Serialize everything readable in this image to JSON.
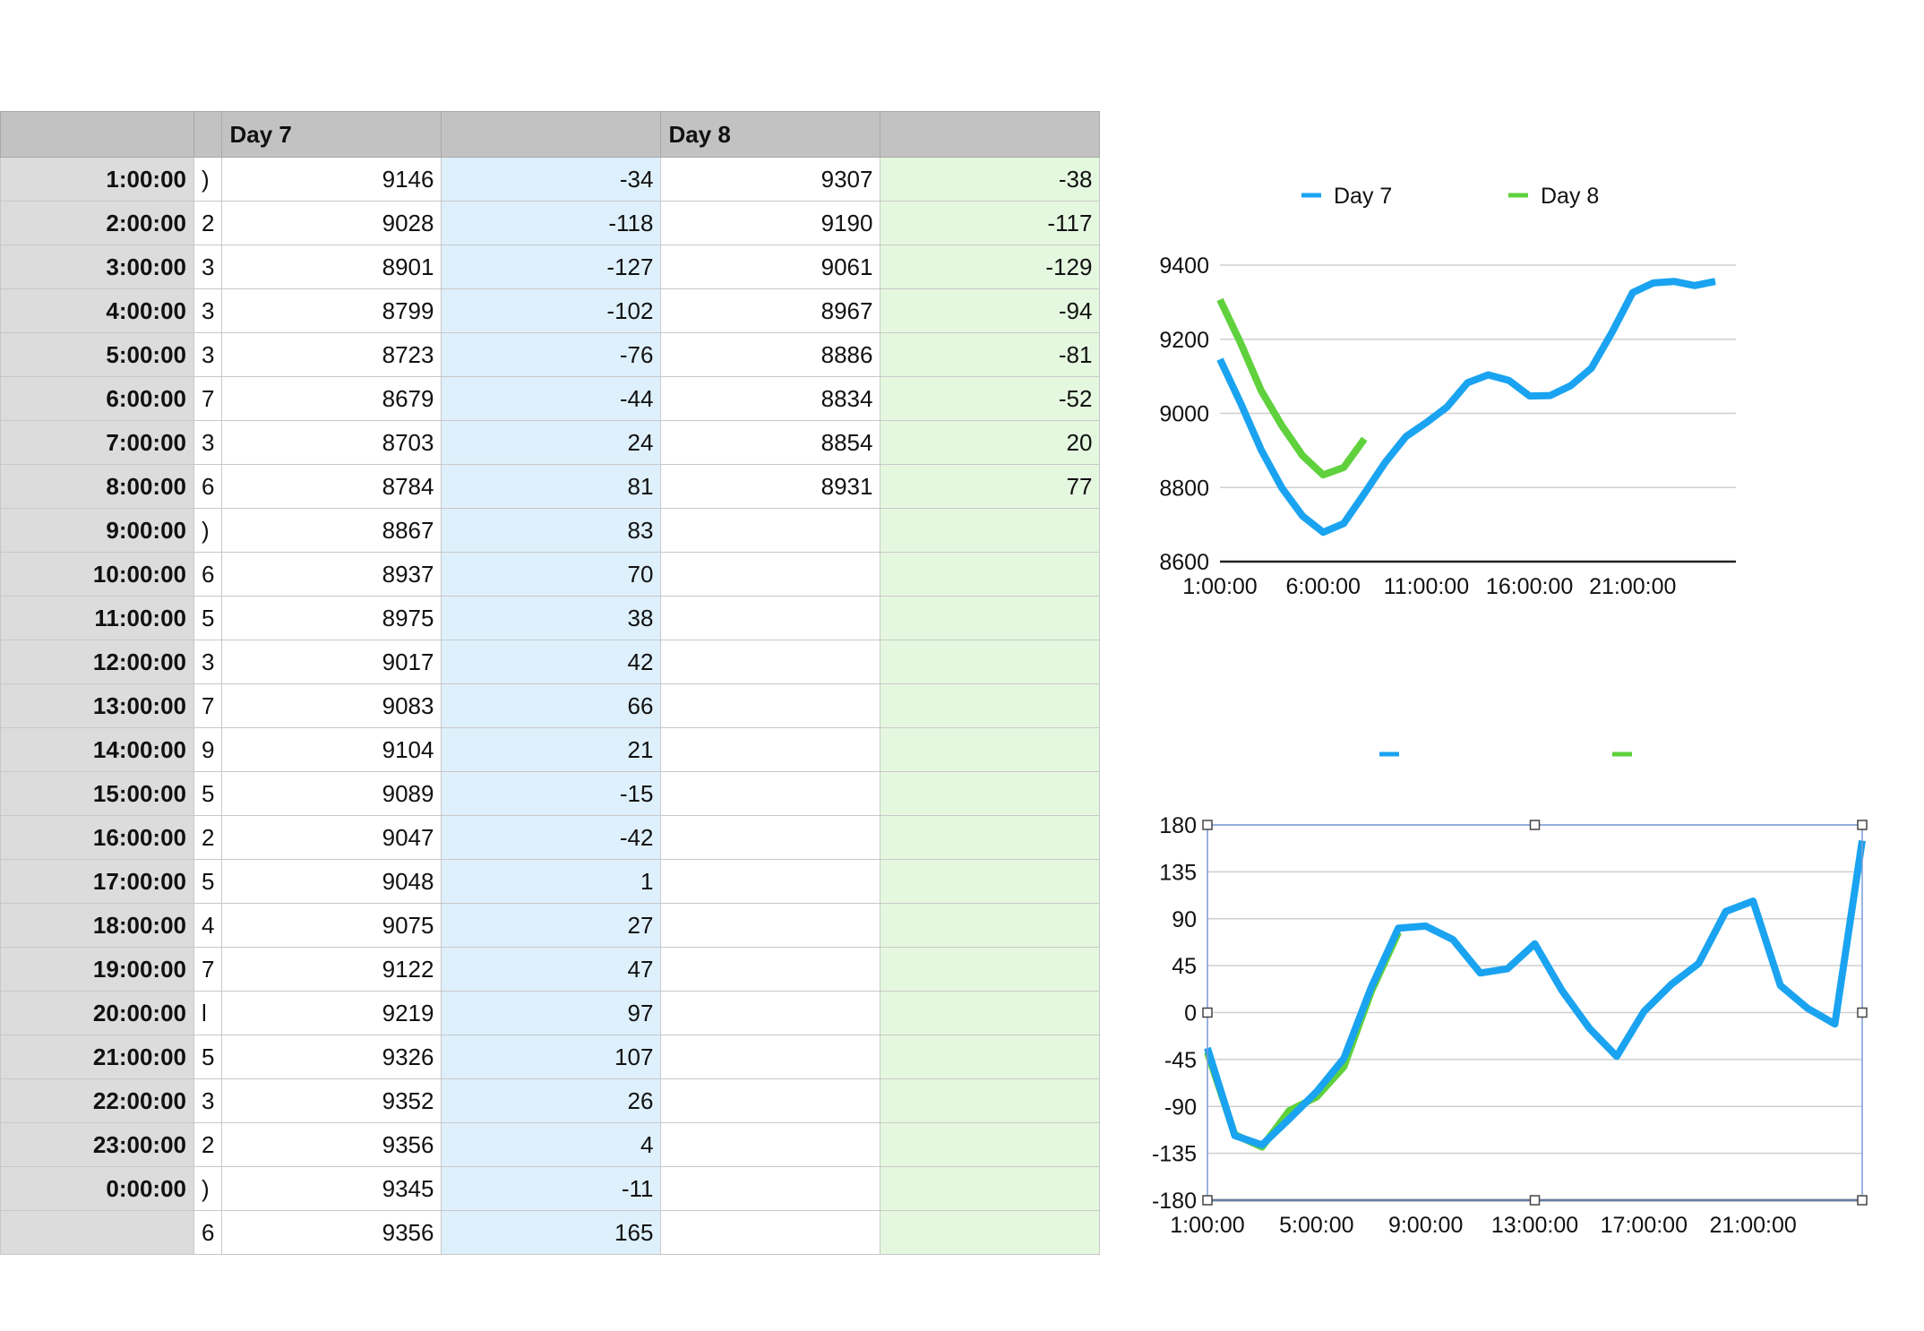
{
  "table": {
    "headers": {
      "day7": "Day 7",
      "day8": "Day 8"
    },
    "rows": [
      {
        "time": "1:00:00",
        "sliver": ")",
        "d7": "9146",
        "d7_delta": "-34",
        "d8": "9307",
        "d8_delta": "-38"
      },
      {
        "time": "2:00:00",
        "sliver": "2",
        "d7": "9028",
        "d7_delta": "-118",
        "d8": "9190",
        "d8_delta": "-117"
      },
      {
        "time": "3:00:00",
        "sliver": "3",
        "d7": "8901",
        "d7_delta": "-127",
        "d8": "9061",
        "d8_delta": "-129"
      },
      {
        "time": "4:00:00",
        "sliver": "3",
        "d7": "8799",
        "d7_delta": "-102",
        "d8": "8967",
        "d8_delta": "-94"
      },
      {
        "time": "5:00:00",
        "sliver": "3",
        "d7": "8723",
        "d7_delta": "-76",
        "d8": "8886",
        "d8_delta": "-81"
      },
      {
        "time": "6:00:00",
        "sliver": "7",
        "d7": "8679",
        "d7_delta": "-44",
        "d8": "8834",
        "d8_delta": "-52"
      },
      {
        "time": "7:00:00",
        "sliver": "3",
        "d7": "8703",
        "d7_delta": "24",
        "d8": "8854",
        "d8_delta": "20"
      },
      {
        "time": "8:00:00",
        "sliver": "6",
        "d7": "8784",
        "d7_delta": "81",
        "d8": "8931",
        "d8_delta": "77"
      },
      {
        "time": "9:00:00",
        "sliver": ")",
        "d7": "8867",
        "d7_delta": "83",
        "d8": "",
        "d8_delta": ""
      },
      {
        "time": "10:00:00",
        "sliver": "6",
        "d7": "8937",
        "d7_delta": "70",
        "d8": "",
        "d8_delta": ""
      },
      {
        "time": "11:00:00",
        "sliver": "5",
        "d7": "8975",
        "d7_delta": "38",
        "d8": "",
        "d8_delta": ""
      },
      {
        "time": "12:00:00",
        "sliver": "3",
        "d7": "9017",
        "d7_delta": "42",
        "d8": "",
        "d8_delta": ""
      },
      {
        "time": "13:00:00",
        "sliver": "7",
        "d7": "9083",
        "d7_delta": "66",
        "d8": "",
        "d8_delta": ""
      },
      {
        "time": "14:00:00",
        "sliver": "9",
        "d7": "9104",
        "d7_delta": "21",
        "d8": "",
        "d8_delta": ""
      },
      {
        "time": "15:00:00",
        "sliver": "5",
        "d7": "9089",
        "d7_delta": "-15",
        "d8": "",
        "d8_delta": ""
      },
      {
        "time": "16:00:00",
        "sliver": "2",
        "d7": "9047",
        "d7_delta": "-42",
        "d8": "",
        "d8_delta": ""
      },
      {
        "time": "17:00:00",
        "sliver": "5",
        "d7": "9048",
        "d7_delta": "1",
        "d8": "",
        "d8_delta": ""
      },
      {
        "time": "18:00:00",
        "sliver": "4",
        "d7": "9075",
        "d7_delta": "27",
        "d8": "",
        "d8_delta": ""
      },
      {
        "time": "19:00:00",
        "sliver": "7",
        "d7": "9122",
        "d7_delta": "47",
        "d8": "",
        "d8_delta": ""
      },
      {
        "time": "20:00:00",
        "sliver": "l",
        "d7": "9219",
        "d7_delta": "97",
        "d8": "",
        "d8_delta": ""
      },
      {
        "time": "21:00:00",
        "sliver": "5",
        "d7": "9326",
        "d7_delta": "107",
        "d8": "",
        "d8_delta": ""
      },
      {
        "time": "22:00:00",
        "sliver": "3",
        "d7": "9352",
        "d7_delta": "26",
        "d8": "",
        "d8_delta": ""
      },
      {
        "time": "23:00:00",
        "sliver": "2",
        "d7": "9356",
        "d7_delta": "4",
        "d8": "",
        "d8_delta": ""
      },
      {
        "time": "0:00:00",
        "sliver": ")",
        "d7": "9345",
        "d7_delta": "-11",
        "d8": "",
        "d8_delta": ""
      },
      {
        "time": "",
        "sliver": "6",
        "d7": "9356",
        "d7_delta": "165",
        "d8": "",
        "d8_delta": ""
      }
    ]
  },
  "colors": {
    "day7": "#1aa3f0",
    "day8": "#5fd13c",
    "blue_fill": "#def0fc",
    "green_fill": "#e4f8df",
    "header": "#c2c2c2"
  },
  "chart_data": [
    {
      "type": "line",
      "legend": "top",
      "grid": true,
      "x": [
        "1:00:00",
        "2:00:00",
        "3:00:00",
        "4:00:00",
        "5:00:00",
        "6:00:00",
        "7:00:00",
        "8:00:00",
        "9:00:00",
        "10:00:00",
        "11:00:00",
        "12:00:00",
        "13:00:00",
        "14:00:00",
        "15:00:00",
        "16:00:00",
        "17:00:00",
        "18:00:00",
        "19:00:00",
        "20:00:00",
        "21:00:00",
        "22:00:00",
        "23:00:00",
        "0:00:00",
        "1:00:00",
        "2:00:00"
      ],
      "xticks": [
        "1:00:00",
        "6:00:00",
        "11:00:00",
        "16:00:00",
        "21:00:00"
      ],
      "ylim": [
        8600,
        9400
      ],
      "yticks": [
        8600,
        8800,
        9000,
        9200,
        9400
      ],
      "series": [
        {
          "name": "Day 7",
          "values": [
            9146,
            9028,
            8901,
            8799,
            8723,
            8679,
            8703,
            8784,
            8867,
            8937,
            8975,
            9017,
            9083,
            9104,
            9089,
            9047,
            9048,
            9075,
            9122,
            9219,
            9326,
            9352,
            9356,
            9345,
            9356
          ]
        },
        {
          "name": "Day 8",
          "values": [
            9307,
            9190,
            9061,
            8967,
            8886,
            8834,
            8854,
            8931
          ]
        }
      ]
    },
    {
      "type": "line",
      "legend": "top",
      "legend_labels_visible": false,
      "grid": true,
      "x": [
        "1:00:00",
        "2:00:00",
        "3:00:00",
        "4:00:00",
        "5:00:00",
        "6:00:00",
        "7:00:00",
        "8:00:00",
        "9:00:00",
        "10:00:00",
        "11:00:00",
        "12:00:00",
        "13:00:00",
        "14:00:00",
        "15:00:00",
        "16:00:00",
        "17:00:00",
        "18:00:00",
        "19:00:00",
        "20:00:00",
        "21:00:00",
        "22:00:00",
        "23:00:00",
        "0:00:00",
        "1:00:00"
      ],
      "xticks": [
        "1:00:00",
        "5:00:00",
        "9:00:00",
        "13:00:00",
        "17:00:00",
        "21:00:00"
      ],
      "ylim": [
        -180,
        180
      ],
      "yticks": [
        -180,
        -135,
        -90,
        -45,
        0,
        45,
        90,
        135,
        180
      ],
      "selected": true,
      "series": [
        {
          "name": "",
          "values": [
            -34,
            -118,
            -127,
            -102,
            -76,
            -44,
            24,
            81,
            83,
            70,
            38,
            42,
            66,
            21,
            -15,
            -42,
            1,
            27,
            47,
            97,
            107,
            26,
            4,
            -11,
            165
          ]
        },
        {
          "name": "",
          "values": [
            -38,
            -117,
            -129,
            -94,
            -81,
            -52,
            20,
            77
          ]
        }
      ]
    }
  ]
}
